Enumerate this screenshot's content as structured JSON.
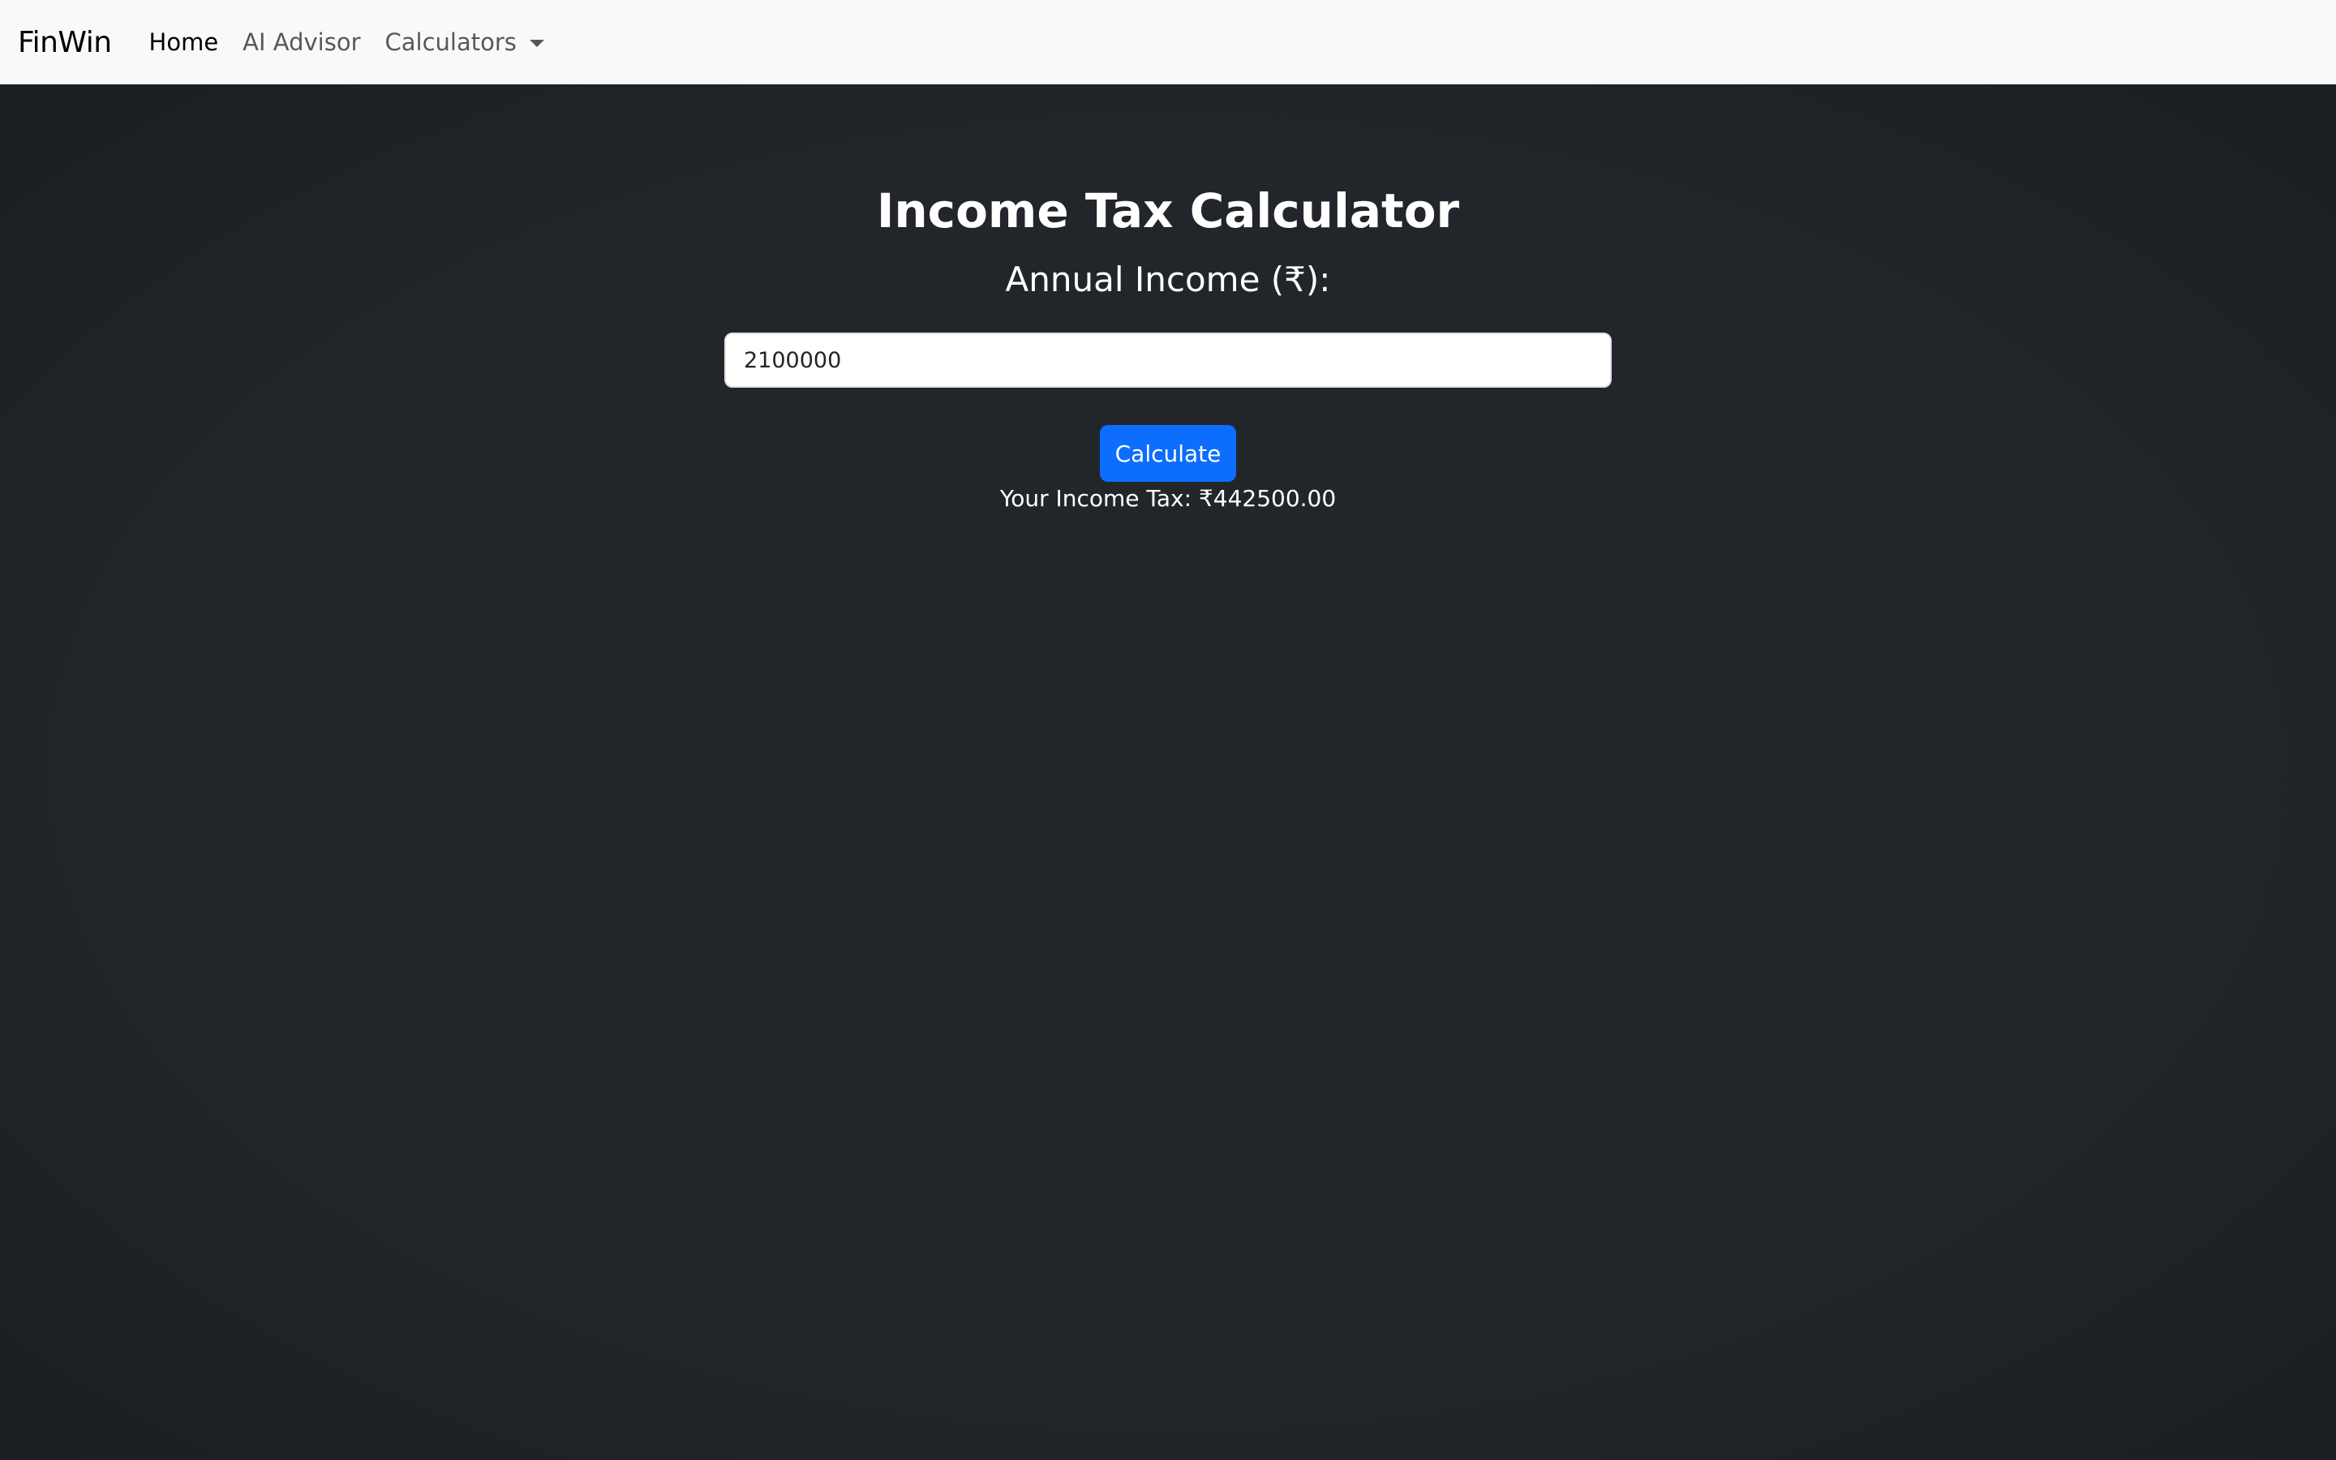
{
  "navbar": {
    "brand": "FinWin",
    "links": [
      {
        "label": "Home",
        "active": true
      },
      {
        "label": "AI Advisor",
        "active": false
      },
      {
        "label": "Calculators",
        "active": false,
        "dropdown": true,
        "icon": "caret-down-icon"
      }
    ]
  },
  "calculator": {
    "title": "Income Tax Calculator",
    "income_label": "Annual Income (₹):",
    "income_value": "2100000",
    "button_label": "Calculate",
    "result_text": "Your Income Tax: ₹442500.00"
  },
  "colors": {
    "navbar_bg": "#f8f9fa",
    "page_bg": "#212529",
    "primary_button": "#0d6efd",
    "text_light": "#ffffff"
  }
}
